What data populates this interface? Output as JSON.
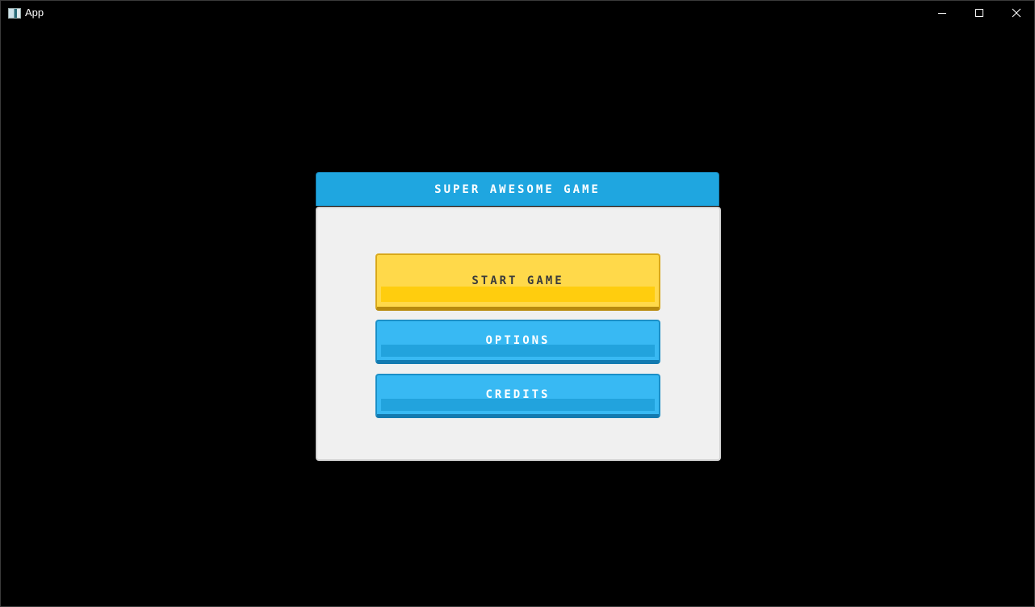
{
  "window": {
    "title": "App",
    "icons": [
      "app-icon",
      "minimize-icon",
      "maximize-icon",
      "close-icon"
    ]
  },
  "menu": {
    "title": "SUPER AWESOME GAME",
    "buttons": {
      "start": "START GAME",
      "options": "OPTIONS",
      "credits": "CREDITS"
    }
  },
  "colors": {
    "header": "#1fa6e0",
    "start_button": "#ffd94a",
    "secondary_button": "#38b9f3",
    "panel_background": "#f0f0f0",
    "screen_background": "#000000"
  }
}
